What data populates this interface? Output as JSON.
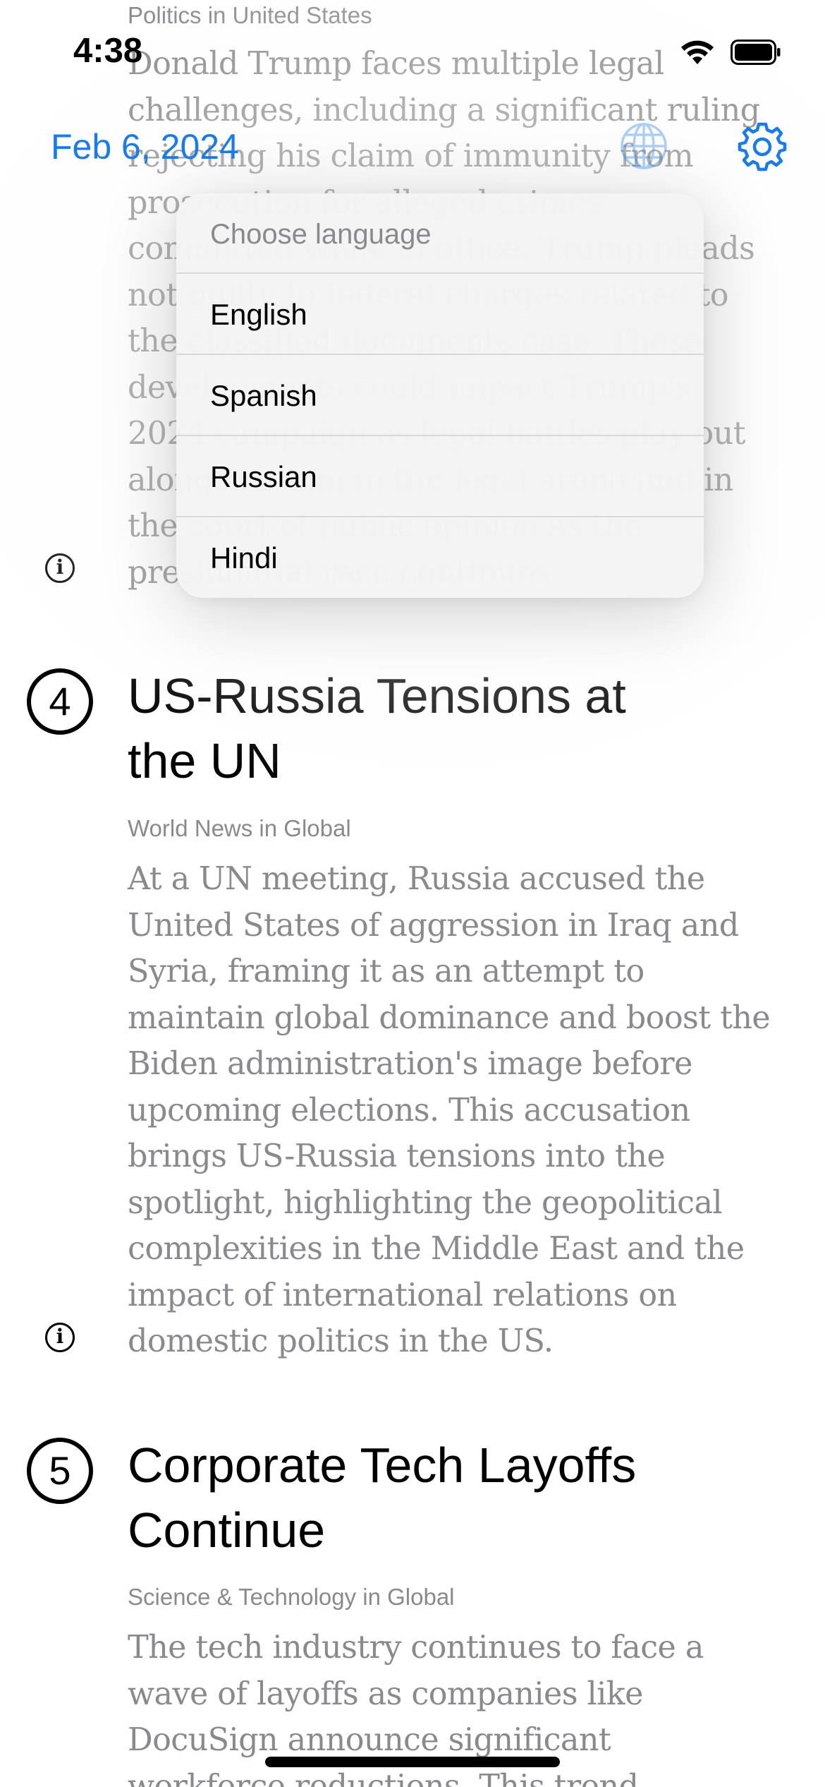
{
  "status_bar": {
    "time": "4:38",
    "icons": [
      "wifi-icon",
      "battery-icon"
    ]
  },
  "nav": {
    "date": "Feb 6, 2024",
    "globe_icon": "globe-icon",
    "settings_icon": "gear-icon",
    "accent_color": "#1a7bea"
  },
  "stories": [
    {
      "category": "Politics in United States",
      "summary": "Donald Trump faces multiple legal challenges, including a significant ruling rejecting his claim of immunity from prosecution for alleged crimes committed while in office. Trump pleads not guilty to federal charges related to the classified documents case. These developments could impact Trump's 2024 campaign as legal battles play out alongside him in the legal arena and in the court of public opinion as the presidential race continues."
    },
    {
      "number": "4",
      "title": "US-Russia Tensions at the UN",
      "category": "World News in Global",
      "summary": "At a UN meeting, Russia accused the United States of aggression in Iraq and Syria, framing it as an attempt to maintain global dominance and boost the Biden administration's image before upcoming elections. This accusation brings US-Russia tensions into the spotlight, highlighting the geopolitical complexities in the Middle East and the impact of international relations on domestic politics in the US."
    },
    {
      "number": "5",
      "title": "Corporate Tech Layoffs Continue",
      "category": "Science & Technology in Global",
      "summary": "The tech industry continues to face a wave of layoffs as companies like DocuSign announce significant workforce reductions. This trend"
    }
  ],
  "info_icon_glyph": "i",
  "language_menu": {
    "header": "Choose language",
    "options": [
      "English",
      "Spanish",
      "Russian",
      "Hindi"
    ]
  }
}
